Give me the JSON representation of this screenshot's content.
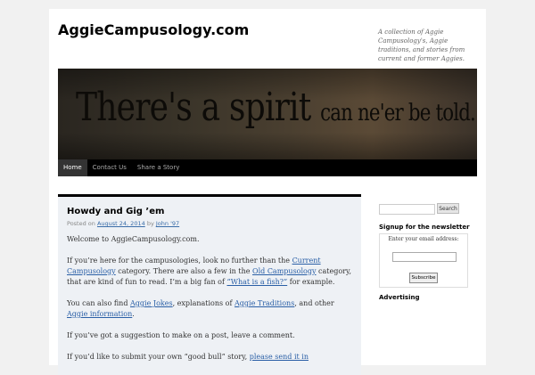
{
  "site": {
    "title": "AggieCampusology.com",
    "tagline": "A collection of Aggie Campusology's, Aggie traditions, and stories from current and former Aggies."
  },
  "banner": {
    "text_main": "There's a spirit",
    "text_small": "can ne'er be told...."
  },
  "nav": {
    "items": [
      {
        "label": "Home",
        "active": true
      },
      {
        "label": "Contact Us",
        "active": false
      },
      {
        "label": "Share a Story",
        "active": false
      }
    ]
  },
  "post": {
    "title": "Howdy and Gig ’em",
    "posted_on_label": "Posted on",
    "date": "August 24, 2014",
    "by_label": "by",
    "author": "John '97",
    "p1": "Welcome to AggieCampusology.com.",
    "p2_a": "If you’re here for the campusologies, look no further than the ",
    "p2_link1": "Current Campusology",
    "p2_b": " category. There are also a few in the ",
    "p2_link2": "Old Campusology",
    "p2_c": " category, that are kind of fun to read. I’m a big fan of ",
    "p2_link3": "“What is a fish?”",
    "p2_d": " for example.",
    "p3_a": "You can also find ",
    "p3_link1": "Aggie Jokes",
    "p3_b": ", explanations of ",
    "p3_link2": "Aggie Traditions",
    "p3_c": ", and other ",
    "p3_link3": "Aggie information",
    "p3_d": ".",
    "p4": "If you’ve got a suggestion to make on a post, leave a comment.",
    "p5_a": "If you’d like to submit your own “good bull” story, ",
    "p5_link": "please send it in"
  },
  "sidebar": {
    "search_button": "Search",
    "search_value": "",
    "newsletter_title": "Signup for the newsletter",
    "newsletter_label": "Enter your email address:",
    "newsletter_value": "",
    "subscribe_button": "Subscribe",
    "advertising_title": "Advertising"
  },
  "colors": {
    "nav_bg": "#000000",
    "link": "#2a5fa6",
    "content_bg": "#eef1f5"
  }
}
